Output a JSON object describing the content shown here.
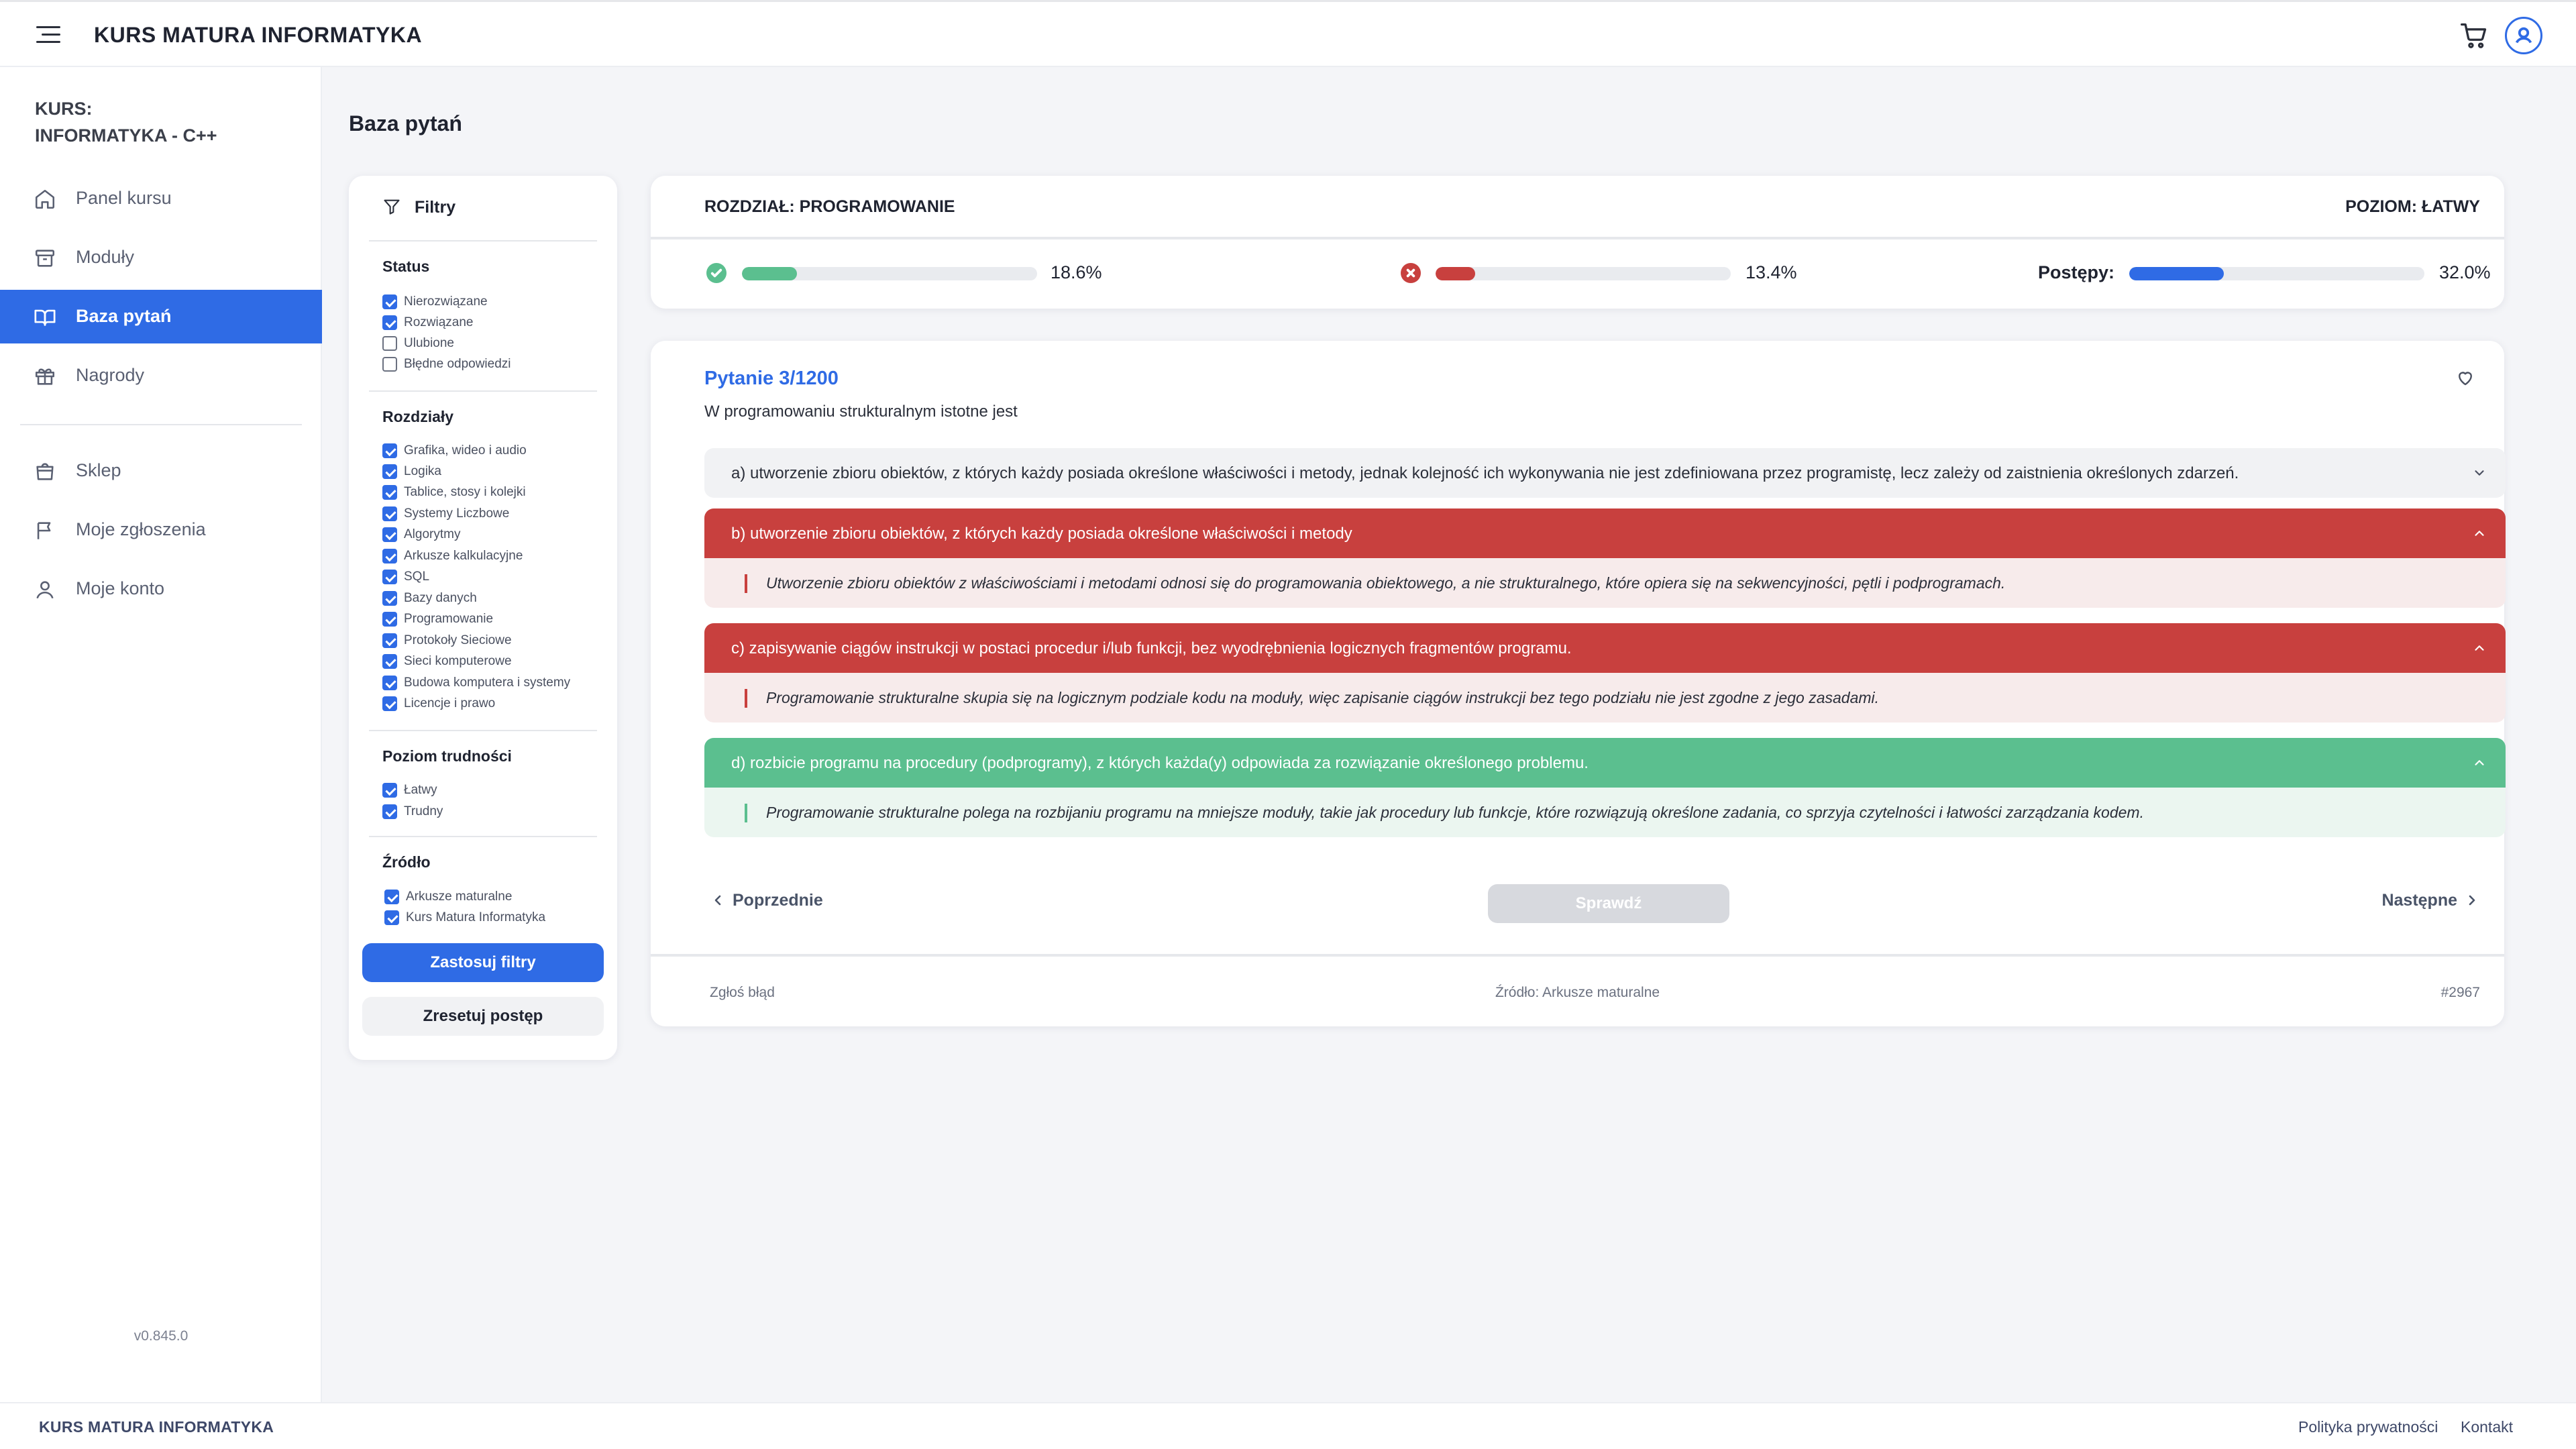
{
  "header": {
    "brand": "KURS MATURA INFORMATYKA"
  },
  "sidebar": {
    "course_label_1": "KURS:",
    "course_label_2": "INFORMATYKA - C++",
    "items": [
      {
        "label": "Panel kursu",
        "icon": "home-icon"
      },
      {
        "label": "Moduły",
        "icon": "archive-icon"
      },
      {
        "label": "Baza pytań",
        "icon": "book-icon",
        "active": true
      },
      {
        "label": "Nagrody",
        "icon": "gift-icon"
      },
      {
        "label": "Sklep",
        "icon": "shopping-bag-icon"
      },
      {
        "label": "Moje zgłoszenia",
        "icon": "flag-icon"
      },
      {
        "label": "Moje konto",
        "icon": "user-icon"
      }
    ],
    "version": "v0.845.0"
  },
  "page": {
    "title": "Baza pytań"
  },
  "filters": {
    "title": "Filtry",
    "status": {
      "title": "Status",
      "items": [
        {
          "label": "Nierozwiązane",
          "checked": true
        },
        {
          "label": "Rozwiązane",
          "checked": true
        },
        {
          "label": "Ulubione",
          "checked": false
        },
        {
          "label": "Błędne odpowiedzi",
          "checked": false
        }
      ]
    },
    "chapters": {
      "title": "Rozdziały",
      "items": [
        {
          "label": "Grafika, wideo i audio",
          "checked": true
        },
        {
          "label": "Logika",
          "checked": true
        },
        {
          "label": "Tablice, stosy i kolejki",
          "checked": true
        },
        {
          "label": "Systemy Liczbowe",
          "checked": true
        },
        {
          "label": "Algorytmy",
          "checked": true
        },
        {
          "label": "Arkusze kalkulacyjne",
          "checked": true
        },
        {
          "label": "SQL",
          "checked": true
        },
        {
          "label": "Bazy danych",
          "checked": true
        },
        {
          "label": "Programowanie",
          "checked": true
        },
        {
          "label": "Protokoły Sieciowe",
          "checked": true
        },
        {
          "label": "Sieci komputerowe",
          "checked": true
        },
        {
          "label": "Budowa komputera i systemy",
          "checked": true
        },
        {
          "label": "Licencje i prawo",
          "checked": true
        }
      ]
    },
    "difficulty": {
      "title": "Poziom trudności",
      "items": [
        {
          "label": "Łatwy",
          "checked": true
        },
        {
          "label": "Trudny",
          "checked": true
        }
      ]
    },
    "source": {
      "title": "Źródło",
      "items": [
        {
          "label": "Arkusze maturalne",
          "checked": true
        },
        {
          "label": "Kurs Matura Informatyka",
          "checked": true
        }
      ]
    },
    "apply_label": "Zastosuj filtry",
    "reset_label": "Zresetuj postęp"
  },
  "stats": {
    "section": "ROZDZIAŁ: PROGRAMOWANIE",
    "level": "POZIOM: ŁATWY",
    "correct_pct": "18.6%",
    "correct_value": 0.186,
    "wrong_pct": "13.4%",
    "wrong_value": 0.134,
    "progress_label": "Postępy:",
    "progress_pct": "32.0%",
    "progress_value": 0.32,
    "colors": {
      "correct": "#5bbf8f",
      "wrong": "#c8403e",
      "progress": "#2f6be5"
    }
  },
  "question": {
    "number": "Pytanie 3/1200",
    "text": "W programowaniu strukturalnym istotne jest",
    "answers": [
      {
        "text": "a) utworzenie zbioru obiektów, z których każdy posiada określone właściwości i metody, jednak kolejność ich wykonywania nie jest zdefiniowana przez programistę, lecz zależy od zaistnienia określonych zdarzeń.",
        "state": "neutral",
        "explanation": ""
      },
      {
        "text": "b) utworzenie zbioru obiektów, z których każdy posiada określone właściwości i metody",
        "state": "wrong",
        "explanation": "Utworzenie zbioru obiektów z właściwościami i metodami odnosi się do programowania obiektowego, a nie strukturalnego, które opiera się na sekwencyjności, pętli i podprogramach."
      },
      {
        "text": "c) zapisywanie ciągów instrukcji w postaci procedur i/lub funkcji, bez wyodrębnienia logicznych fragmentów programu.",
        "state": "wrong",
        "explanation": "Programowanie strukturalne skupia się na logicznym podziale kodu na moduły, więc zapisanie ciągów instrukcji bez tego podziału nie jest zgodne z jego zasadami."
      },
      {
        "text": "d) rozbicie programu na procedury (podprogramy), z których każda(y) odpowiada za rozwiązanie określonego problemu.",
        "state": "right",
        "explanation": "Programowanie strukturalne polega na rozbijaniu programu na mniejsze moduły, takie jak procedury lub funkcje, które rozwiązują określone zadania, co sprzyja czytelności i łatwości zarządzania kodem."
      }
    ],
    "prev_label": "Poprzednie",
    "check_label": "Sprawdź",
    "next_label": "Następne",
    "report_label": "Zgłoś błąd",
    "source_label": "Źródło: Arkusze maturalne",
    "id_label": "#2967"
  },
  "footer": {
    "brand": "KURS MATURA INFORMATYKA",
    "privacy": "Polityka prywatności",
    "contact": "Kontakt"
  }
}
